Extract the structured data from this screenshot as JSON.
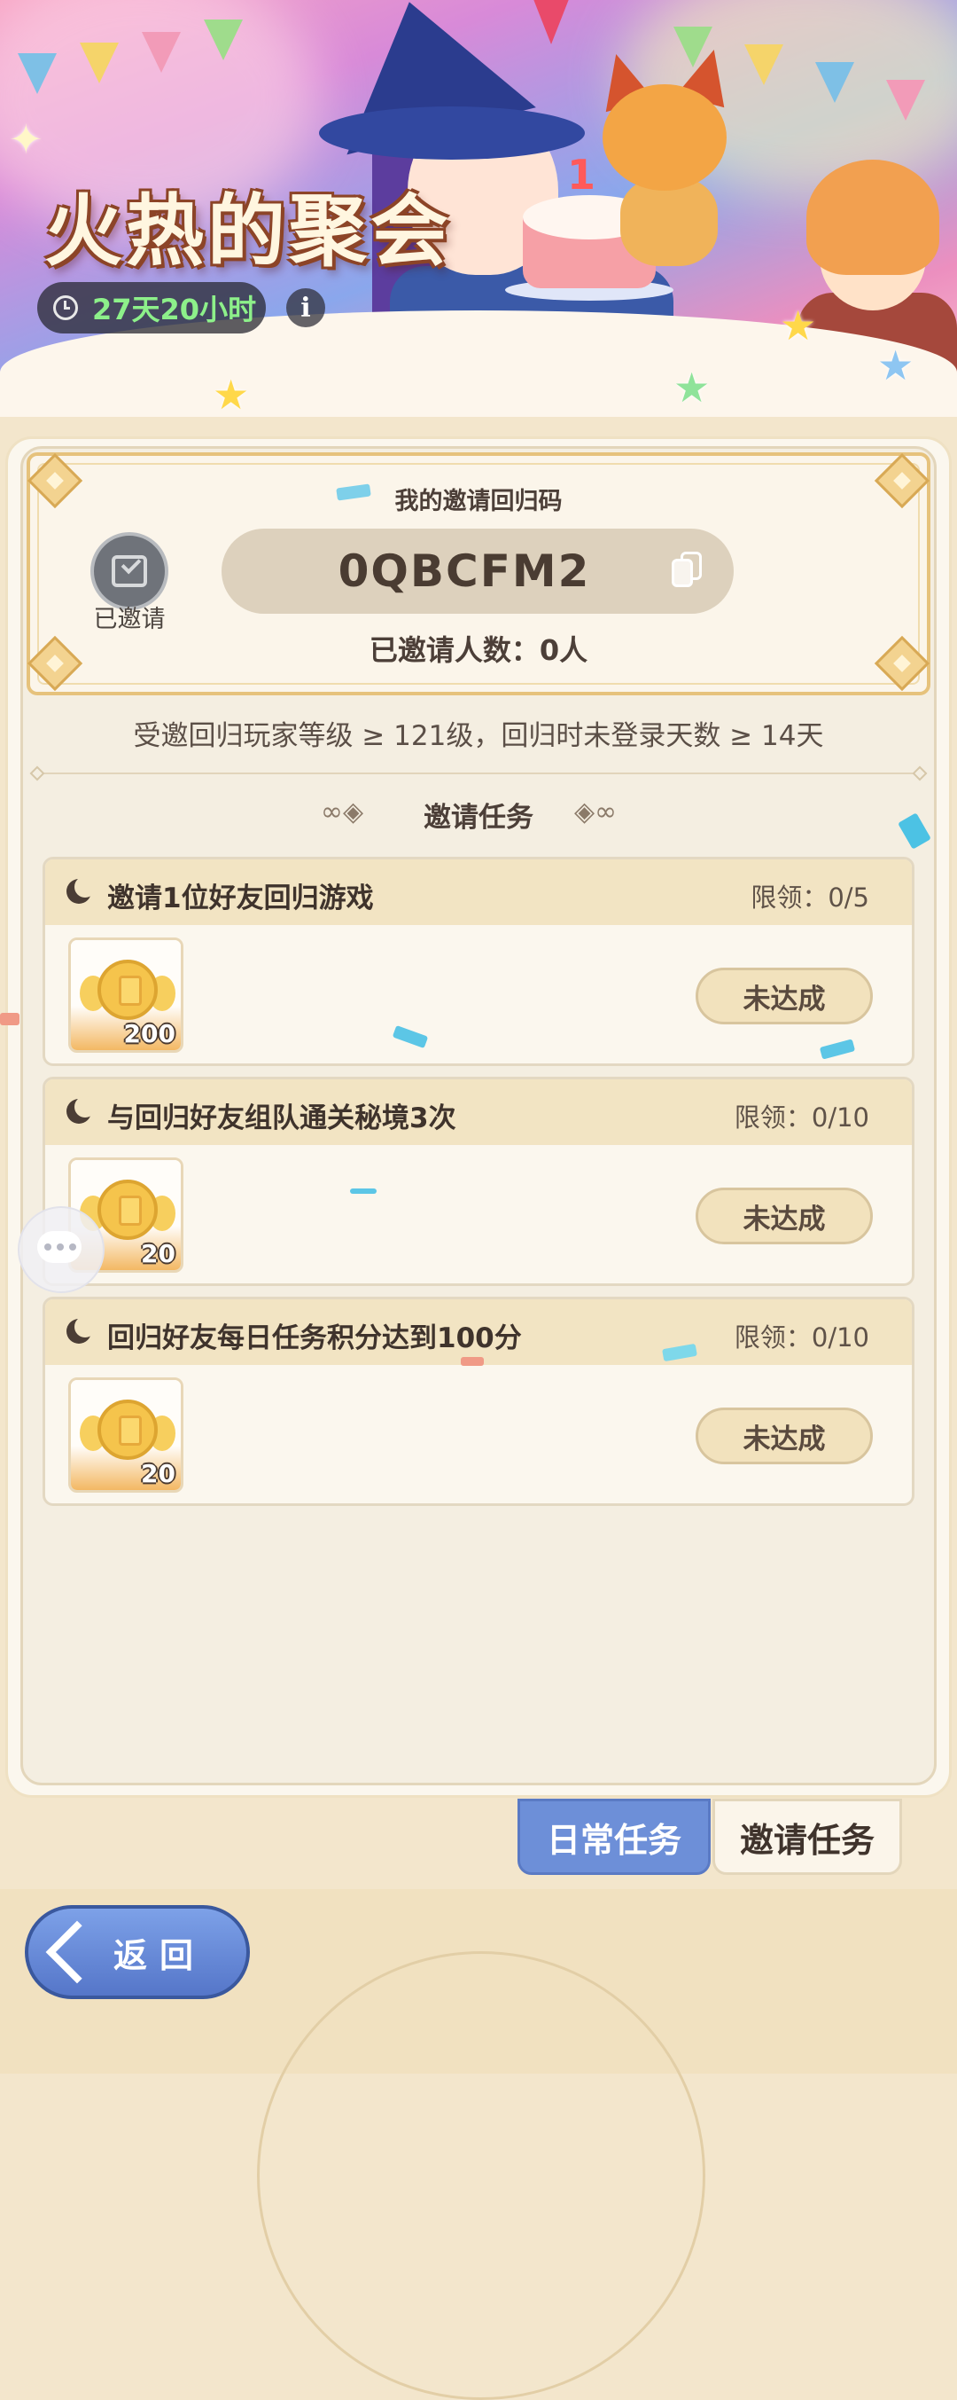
{
  "event": {
    "title": "火热的聚会",
    "timer": "27天20小时",
    "info_icon": "i"
  },
  "invite_card": {
    "title": "我的邀请回归码",
    "invited_label": "已邀请",
    "code": "0QBCFM2",
    "invite_count": "已邀请人数：0人"
  },
  "rule_text": "受邀回归玩家等级 ≥ 121级，回归时未登录天数 ≥ 14天",
  "section_title": "邀请任务",
  "section_left_ornament": "∞◈",
  "section_right_ornament": "◈∞",
  "tasks": [
    {
      "name": "邀请1位好友回归游戏",
      "limit": "限领：0/5",
      "reward_amount": "200",
      "status": "未达成"
    },
    {
      "name": "与回归好友组队通关秘境3次",
      "limit": "限领：0/10",
      "reward_amount": "20",
      "status": "未达成"
    },
    {
      "name": "回归好友每日任务积分达到100分",
      "limit": "限领：0/10",
      "reward_amount": "20",
      "status": "未达成"
    }
  ],
  "tabs": {
    "daily": "日常任务",
    "invite": "邀请任务"
  },
  "back_label": "返回",
  "colors": {
    "timer_text": "#8df08a",
    "daily_tab": "#6d8fd8",
    "back_button": "#5576c9"
  }
}
